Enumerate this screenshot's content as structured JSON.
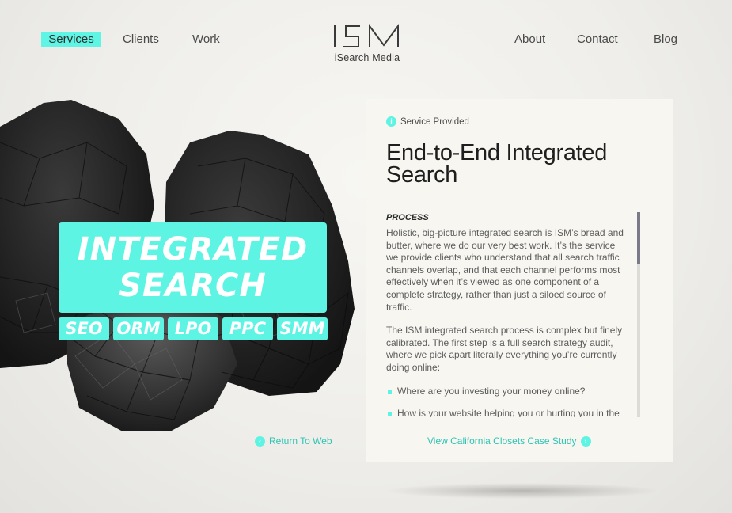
{
  "nav": {
    "services": "Services",
    "clients": "Clients",
    "work": "Work",
    "about": "About",
    "contact": "Contact",
    "blog": "Blog"
  },
  "logo": {
    "mark": "ISM",
    "subtitle": "iSearch Media"
  },
  "hero": {
    "title_line1": "INTEGRATED",
    "title_line2": "SEARCH",
    "tags": [
      "SEO",
      "ORM",
      "LPO",
      "PPC",
      "SMM"
    ],
    "return_link": "Return To Web"
  },
  "panel": {
    "service_label": "Service Provided",
    "title": "End-to-End Integrated Search",
    "section_heading": "PROCESS",
    "paragraph1": "Holistic, big-picture integrated search is ISM’s bread and butter, where we do our very best work.  It’s the service we provide clients who understand that all search traffic channels overlap, and that each channel performs most effectively when it’s viewed as one component of a complete strategy, rather than just a siloed source of traffic.",
    "paragraph2": "The ISM integrated search process is complex but finely calibrated.  The first step is a full search strategy audit, where we pick apart literally everything you’re currently doing online:",
    "bullets": [
      "Where are you investing your money online?",
      "How is your website helping you or hurting you in the search results?"
    ],
    "case_study_link": "View California Closets Case Study",
    "scroll_position": 0
  },
  "colors": {
    "accent": "#5ef4e3",
    "link": "#2fc4b3",
    "text": "#5c5c5c",
    "title": "#1e1e1e"
  },
  "icons": [
    "info-icon",
    "back-arrow-icon",
    "forward-arrow-icon"
  ]
}
